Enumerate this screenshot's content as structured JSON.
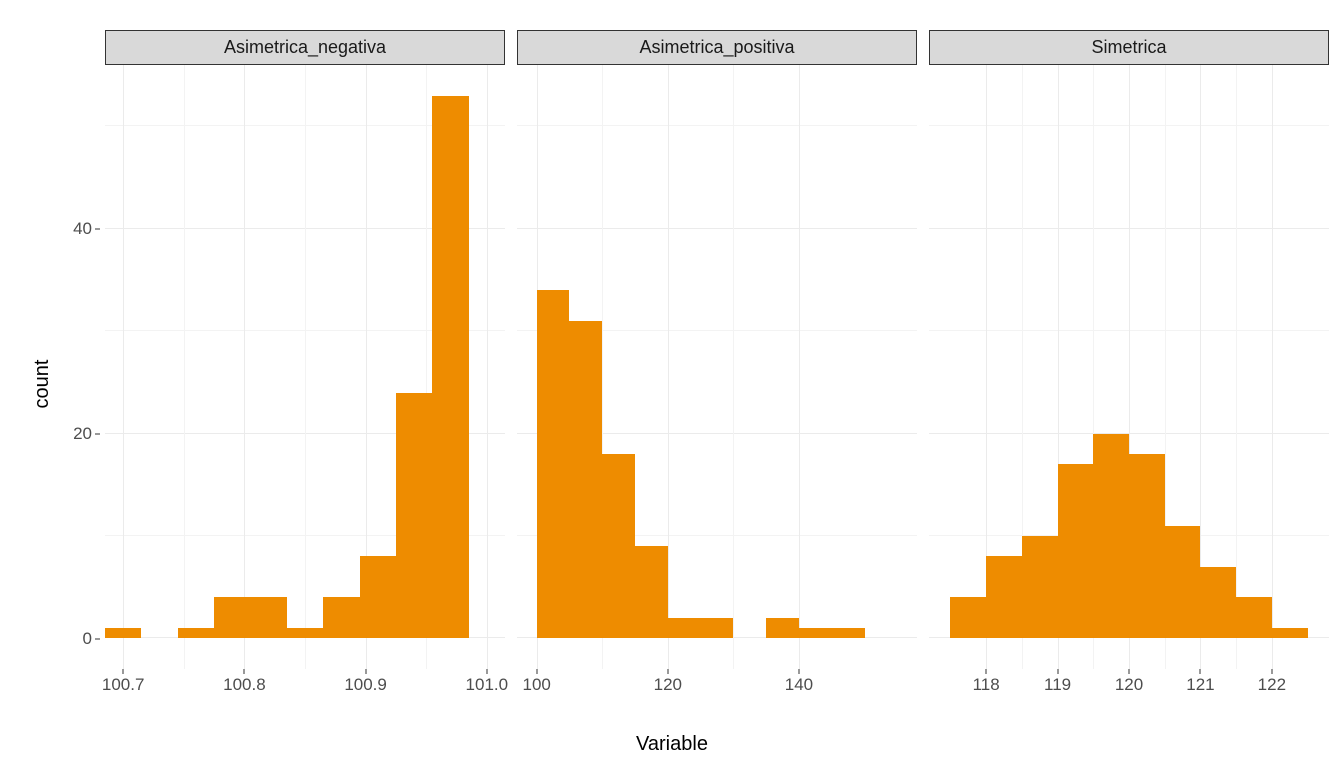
{
  "xlabel": "Variable",
  "ylabel": "count",
  "y_axis": {
    "min": -3,
    "max": 56,
    "ticks": [
      0,
      20,
      40
    ]
  },
  "bar_color": "#ee8c00",
  "chart_data": [
    {
      "facet": "Asimetrica_negativa",
      "type": "bar",
      "x_range": [
        100.685,
        101.015
      ],
      "x_ticks": [
        100.7,
        100.8,
        100.9,
        101.0
      ],
      "bin_width": 0.03,
      "bars": [
        {
          "x": 100.7,
          "count": 1
        },
        {
          "x": 100.76,
          "count": 1
        },
        {
          "x": 100.79,
          "count": 4
        },
        {
          "x": 100.82,
          "count": 4
        },
        {
          "x": 100.85,
          "count": 1
        },
        {
          "x": 100.88,
          "count": 4
        },
        {
          "x": 100.91,
          "count": 8
        },
        {
          "x": 100.94,
          "count": 24
        },
        {
          "x": 100.97,
          "count": 53
        }
      ]
    },
    {
      "facet": "Asimetrica_positiva",
      "type": "bar",
      "x_range": [
        97,
        158
      ],
      "x_ticks": [
        100,
        120,
        140
      ],
      "bin_width": 5,
      "bars": [
        {
          "x": 102.5,
          "count": 34
        },
        {
          "x": 107.5,
          "count": 31
        },
        {
          "x": 112.5,
          "count": 18
        },
        {
          "x": 117.5,
          "count": 9
        },
        {
          "x": 122.5,
          "count": 2
        },
        {
          "x": 127.5,
          "count": 2
        },
        {
          "x": 137.5,
          "count": 2
        },
        {
          "x": 142.5,
          "count": 1
        },
        {
          "x": 147.5,
          "count": 1
        }
      ]
    },
    {
      "facet": "Simetrica",
      "type": "bar",
      "x_range": [
        117.2,
        122.8
      ],
      "x_ticks": [
        118,
        119,
        120,
        121,
        122
      ],
      "bin_width": 0.5,
      "bars": [
        {
          "x": 117.75,
          "count": 4
        },
        {
          "x": 118.25,
          "count": 8
        },
        {
          "x": 118.75,
          "count": 10
        },
        {
          "x": 119.25,
          "count": 17
        },
        {
          "x": 119.75,
          "count": 20
        },
        {
          "x": 120.25,
          "count": 18
        },
        {
          "x": 120.75,
          "count": 11
        },
        {
          "x": 121.25,
          "count": 7
        },
        {
          "x": 121.75,
          "count": 4
        },
        {
          "x": 122.25,
          "count": 1
        }
      ]
    }
  ]
}
